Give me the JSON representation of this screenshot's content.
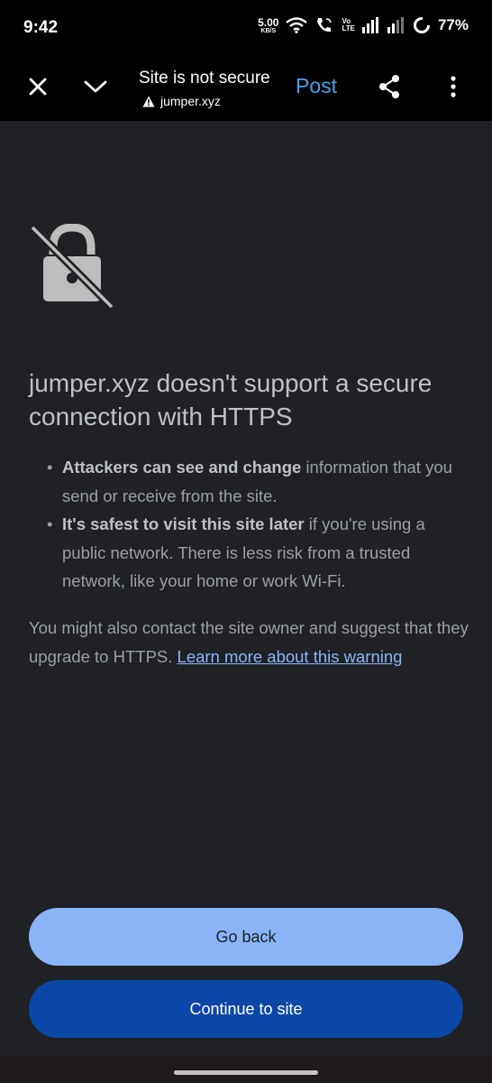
{
  "status_bar": {
    "time": "9:42",
    "net_speed_value": "5.00",
    "net_speed_unit": "KB/S",
    "volte_top": "Vo",
    "volte_bottom": "LTE",
    "battery": "77%"
  },
  "toolbar": {
    "title": "Site is not secure",
    "url": "jumper.xyz",
    "post_label": "Post",
    "icons": [
      "close-icon",
      "chevron-down-icon",
      "share-icon",
      "more-vert-icon"
    ]
  },
  "content": {
    "heading": "jumper.xyz doesn't support a secure connection with HTTPS",
    "bullets": [
      {
        "bold": "Attackers can see and change",
        "text": " information that you send or receive from the site."
      },
      {
        "bold": "It's safest to visit this site later",
        "text": " if you're using a public network. There is less risk from a trusted network, like your home or work Wi-Fi."
      }
    ],
    "paragraph": "You might also contact the site owner and suggest that they upgrade to HTTPS. ",
    "learn_more": "Learn more about this warning"
  },
  "buttons": {
    "go_back": "Go back",
    "continue": "Continue to site"
  },
  "colors": {
    "background": "#202124",
    "accent": "#8ab4f8",
    "primary_button": "#0b47a6",
    "post_link": "#4a9ff0"
  }
}
